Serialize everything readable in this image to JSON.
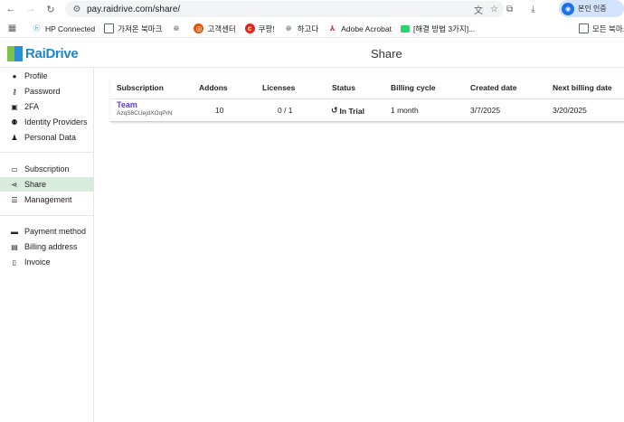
{
  "browser": {
    "url": "pay.raidrive.com/share/",
    "profile_label": "본인 인증"
  },
  "bookmarks": [
    {
      "label": "HP Connected",
      "icon": "hp-icon"
    },
    {
      "label": "가져온 북마크",
      "icon": "folder-icon"
    },
    {
      "label": "",
      "icon": "globe-icon"
    },
    {
      "label": "고객센터",
      "icon": "orange-circle-icon"
    },
    {
      "label": "쿠팡!",
      "icon": "coupang-icon"
    },
    {
      "label": "하고다",
      "icon": "globe-icon"
    },
    {
      "label": "Adobe Acrobat",
      "icon": "pdf-icon"
    },
    {
      "label": "[해결 방법 3가지]...",
      "icon": "chat-icon"
    }
  ],
  "bookmarks_right": {
    "label": "모든 북마크",
    "icon": "folder-icon"
  },
  "app": {
    "logo_text": "RaiDrive",
    "page_title": "Share"
  },
  "sidebar": {
    "group1": [
      {
        "label": "Profile",
        "icon": "user-circle-icon"
      },
      {
        "label": "Password",
        "icon": "key-icon"
      },
      {
        "label": "2FA",
        "icon": "lock-icon"
      },
      {
        "label": "Identity Providers",
        "icon": "users-icon"
      },
      {
        "label": "Personal Data",
        "icon": "user-secret-icon"
      }
    ],
    "group2": [
      {
        "label": "Subscription",
        "icon": "calendar-icon"
      },
      {
        "label": "Share",
        "icon": "share-icon"
      },
      {
        "label": "Management",
        "icon": "sliders-icon"
      }
    ],
    "group3": [
      {
        "label": "Payment method",
        "icon": "credit-card-icon"
      },
      {
        "label": "Billing address",
        "icon": "address-card-icon"
      },
      {
        "label": "Invoice",
        "icon": "invoice-icon"
      }
    ]
  },
  "table": {
    "headers": [
      "Subscription",
      "Addons",
      "Licenses",
      "Status",
      "Billing cycle",
      "Created date",
      "Next billing date"
    ],
    "rows": [
      {
        "name": "Team",
        "id": "AzqS6CUejdXOqPrN",
        "addons": "10",
        "licenses": "0 / 1",
        "status": "In Trial",
        "billing_cycle": "1 month",
        "created": "3/7/2025",
        "next_billing": "3/20/2025"
      }
    ]
  },
  "colors": {
    "accent_active": "#d8ecdd",
    "link_purple": "#5b3fd1",
    "logo_blue": "#1c87c9"
  }
}
